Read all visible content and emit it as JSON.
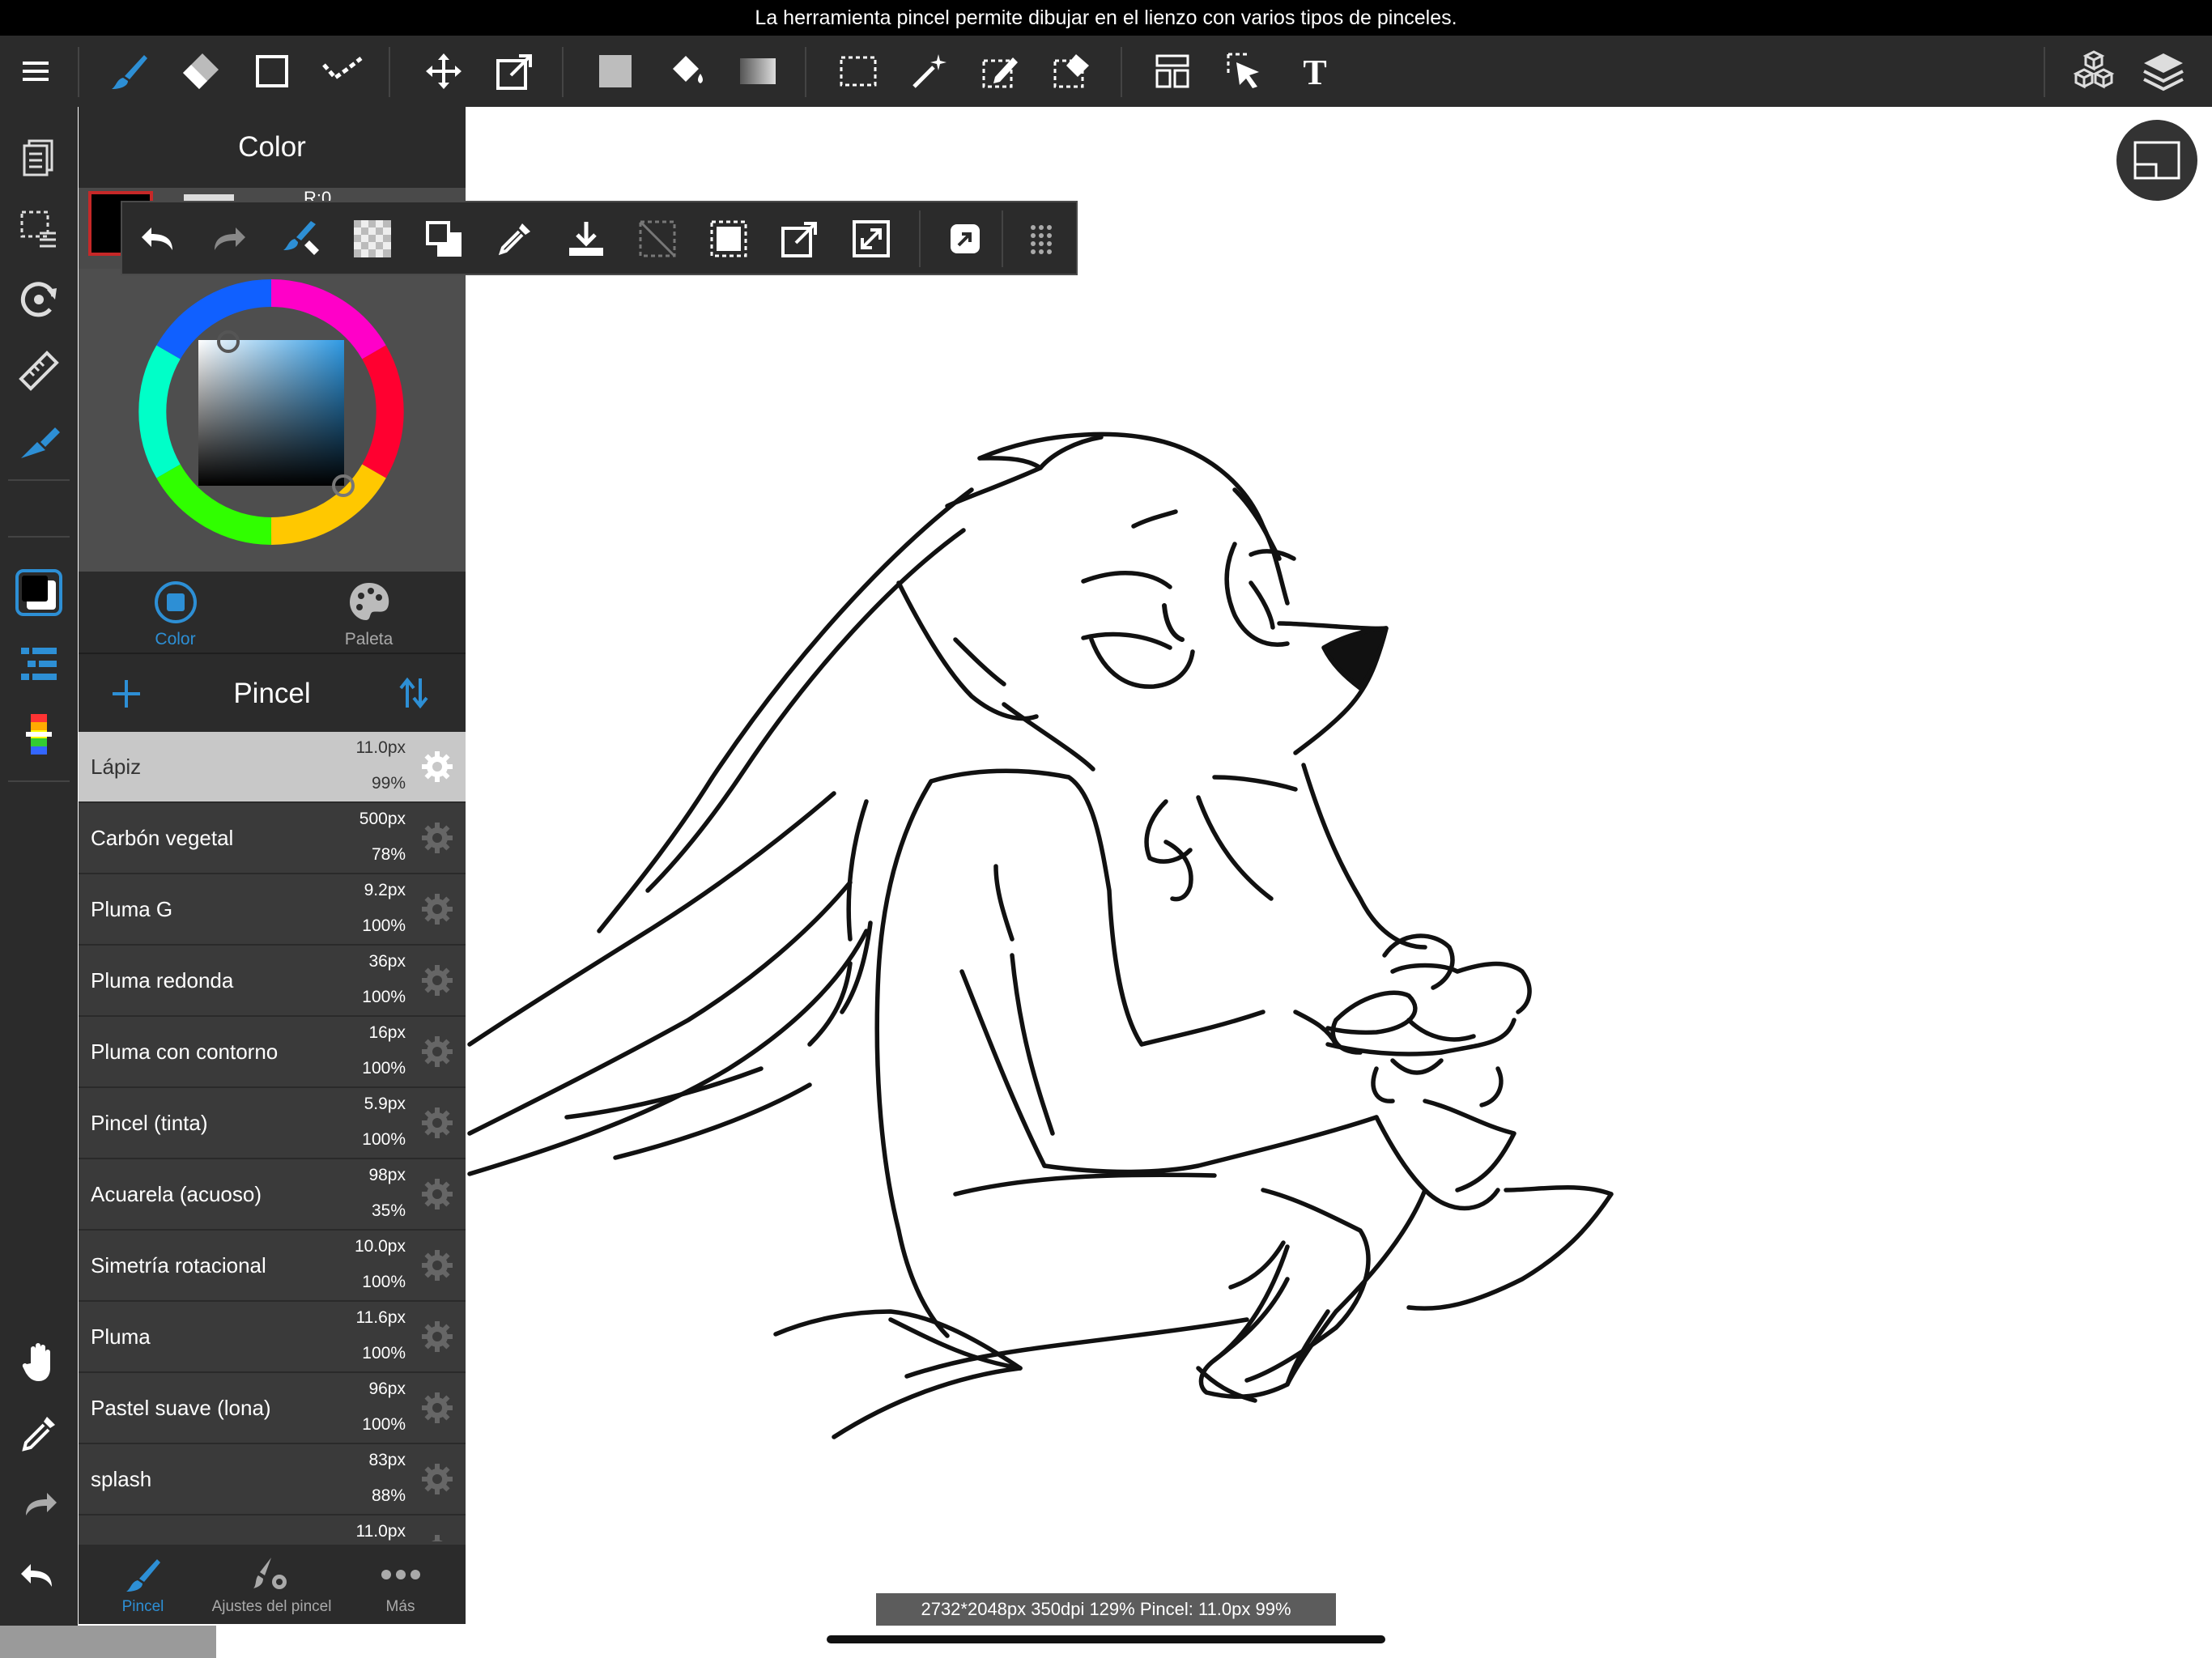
{
  "info_bar": {
    "message": "La herramienta pincel permite dibujar en el lienzo con varios tipos de pinceles."
  },
  "color_panel": {
    "title": "Color",
    "rgb_label": "R:0",
    "tabs": [
      {
        "label": "Color",
        "active": true
      },
      {
        "label": "Paleta",
        "active": false
      }
    ]
  },
  "brush_panel": {
    "title": "Pincel",
    "brushes": [
      {
        "name": "Lápiz",
        "size": "11.0px",
        "opacity": "99%",
        "selected": true
      },
      {
        "name": "Carbón vegetal",
        "size": "500px",
        "opacity": "78%"
      },
      {
        "name": "Pluma G",
        "size": "9.2px",
        "opacity": "100%"
      },
      {
        "name": "Pluma redonda",
        "size": "36px",
        "opacity": "100%"
      },
      {
        "name": "Pluma con contorno",
        "size": "16px",
        "opacity": "100%"
      },
      {
        "name": "Pincel (tinta)",
        "size": "5.9px",
        "opacity": "100%"
      },
      {
        "name": "Acuarela (acuoso)",
        "size": "98px",
        "opacity": "35%"
      },
      {
        "name": "Simetría rotacional",
        "size": "10.0px",
        "opacity": "100%"
      },
      {
        "name": "Pluma",
        "size": "11.6px",
        "opacity": "100%"
      },
      {
        "name": "Pastel suave (lona)",
        "size": "96px",
        "opacity": "100%"
      },
      {
        "name": "splash",
        "size": "83px",
        "opacity": "88%"
      },
      {
        "name": "",
        "size": "11.0px",
        "opacity": ""
      }
    ],
    "tabs": [
      {
        "label": "Pincel",
        "active": true
      },
      {
        "label": "Ajustes del pincel",
        "active": false
      },
      {
        "label": "Más",
        "active": false
      }
    ]
  },
  "status_bar": {
    "text": "2732*2048px 350dpi 129% Pincel: 11.0px 99%"
  },
  "colors": {
    "accent": "#2d8fd5",
    "toolbar_bg": "#2b2b2b",
    "panel_bg": "#3a3a3a",
    "selected_row": "#c8c8c8",
    "current_color": "#000000"
  },
  "toolbar_icons": [
    "menu-icon",
    "brush-icon",
    "eraser-icon",
    "shape-icon",
    "line-icon",
    "move-icon",
    "transform-icon",
    "fill-color-icon",
    "bucket-icon",
    "gradient-icon",
    "select-rect-icon",
    "magic-wand-icon",
    "select-pen-icon",
    "select-eraser-icon",
    "layout-icon",
    "select-move-icon",
    "text-icon",
    "3d-model-icon",
    "layers-icon"
  ]
}
